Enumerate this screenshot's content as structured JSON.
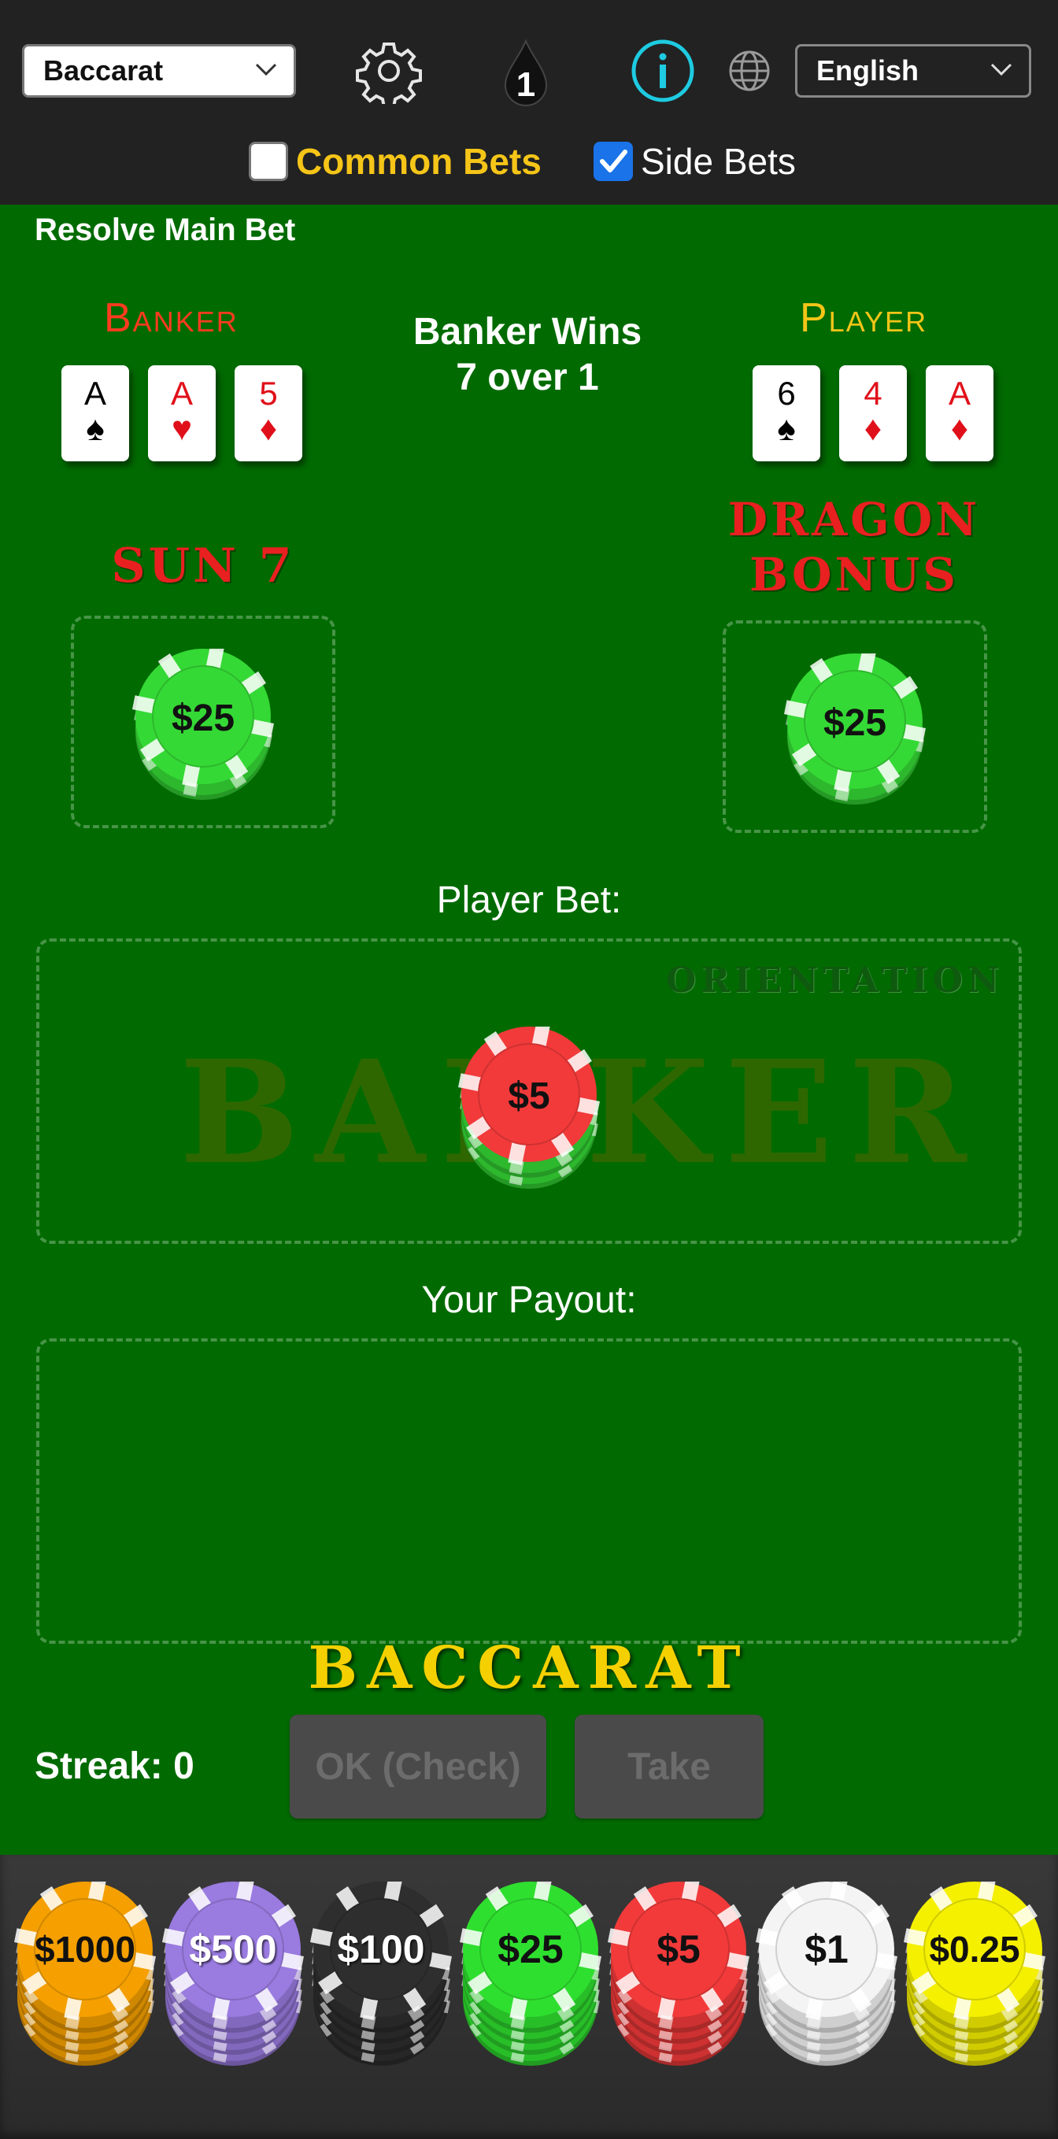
{
  "header": {
    "game_select": {
      "value": "Baccarat"
    },
    "language_select": {
      "value": "English"
    },
    "round_badge": "1",
    "common_bets": {
      "label": "Common Bets",
      "checked": false
    },
    "side_bets": {
      "label": "Side Bets",
      "checked": true
    },
    "colors": {
      "info_accent": "#1ecbe1",
      "common_label": "#f5c518",
      "checkbox_checked": "#1a73e8"
    }
  },
  "table": {
    "mode_text": "Resolve Main Bet",
    "banker": {
      "title": "Banker",
      "cards": [
        {
          "rank": "A",
          "suit": "♠",
          "color": "black"
        },
        {
          "rank": "A",
          "suit": "♥",
          "color": "red"
        },
        {
          "rank": "5",
          "suit": "♦",
          "color": "red"
        }
      ]
    },
    "player": {
      "title": "Player",
      "cards": [
        {
          "rank": "6",
          "suit": "♠",
          "color": "black"
        },
        {
          "rank": "4",
          "suit": "♦",
          "color": "red"
        },
        {
          "rank": "A",
          "suit": "♦",
          "color": "red"
        }
      ]
    },
    "result": {
      "line1": "Banker Wins",
      "line2": "7 over 1"
    },
    "side_bets": {
      "sun7": {
        "title": "SUN 7",
        "chip": "$25"
      },
      "dragon_bonus": {
        "title_line1": "DRAGON",
        "title_line2": "BONUS",
        "chip": "$25"
      }
    },
    "player_bet": {
      "label": "Player Bet:",
      "orientation": "ORIENTATION",
      "watermark": "BANKER",
      "chip": "$5"
    },
    "payout": {
      "label": "Your Payout:"
    },
    "game_title": "BACCARAT",
    "streak": "Streak: 0",
    "buttons": {
      "ok": "OK (Check)",
      "take": "Take"
    }
  },
  "chip_tray": [
    {
      "label": "$1000",
      "color": "#f5a000",
      "text_color": "#111111"
    },
    {
      "label": "$500",
      "color": "#9a7be0",
      "text_color": "#ffffff"
    },
    {
      "label": "$100",
      "color": "#2e2e2e",
      "text_color": "#ffffff"
    },
    {
      "label": "$25",
      "color": "#2fdf2f",
      "text_color": "#111111"
    },
    {
      "label": "$5",
      "color": "#f23a3a",
      "text_color": "#111111"
    },
    {
      "label": "$1",
      "color": "#f4f4f4",
      "text_color": "#111111"
    },
    {
      "label": "$0.25",
      "color": "#f5f000",
      "text_color": "#111111"
    }
  ]
}
